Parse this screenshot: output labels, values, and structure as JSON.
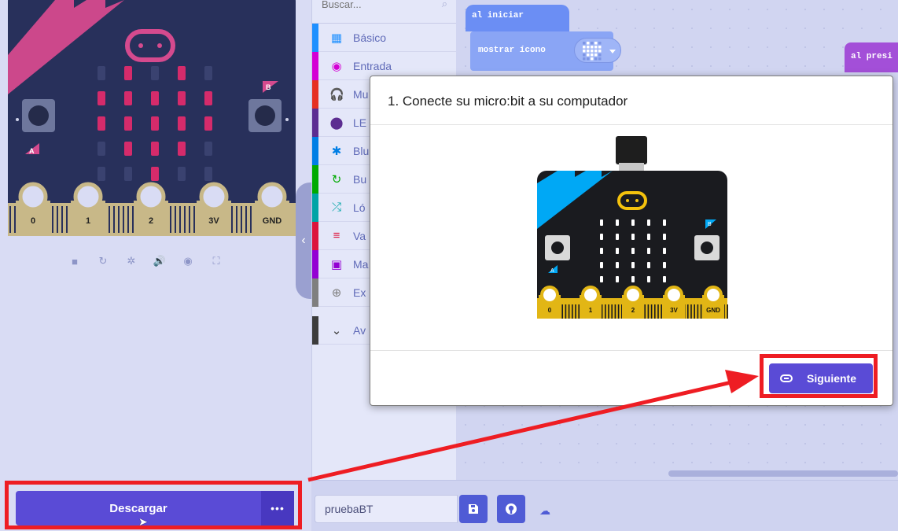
{
  "colors": {
    "accent": "#5a4bd6",
    "highlight": "#ee1d23",
    "sim_board": "#28305b",
    "sim_led": "#d52b6b",
    "sim_logo": "#d54a8e",
    "sim_corner": "#d54a8e",
    "modal_board": "#1a1b1f",
    "modal_corner": "#00a8f5",
    "gold": "#e2b615"
  },
  "simulator": {
    "pin_labels": [
      "0",
      "1",
      "2",
      "3V",
      "GND"
    ],
    "button_a": "A",
    "button_b": "B",
    "toolbar": [
      {
        "name": "stop-icon",
        "glyph": "■"
      },
      {
        "name": "restart-icon",
        "glyph": "↻"
      },
      {
        "name": "debug-icon",
        "glyph": "✲"
      },
      {
        "name": "mute-icon",
        "glyph": "🔊"
      },
      {
        "name": "screenshot-icon",
        "glyph": "◉"
      },
      {
        "name": "fullscreen-icon",
        "glyph": "⛶"
      }
    ],
    "collapse_icon": "‹"
  },
  "toolbox": {
    "search": {
      "placeholder": "Buscar...",
      "icon": "search-icon",
      "icon_glyph": "⌕"
    },
    "categories": [
      {
        "label": "Básico",
        "color": "#1e90ff",
        "icon": "grid-icon",
        "glyph": "▦"
      },
      {
        "label": "Entrada",
        "color": "#d400d4",
        "icon": "target-icon",
        "glyph": "◉"
      },
      {
        "label": "Mu",
        "color": "#e63022",
        "icon": "headphones-icon",
        "glyph": "🎧"
      },
      {
        "label": "LE",
        "color": "#5c2d91",
        "icon": "toggle-icon",
        "glyph": "⬤"
      },
      {
        "label": "Blu",
        "color": "#007ee5",
        "icon": "bluetooth-icon",
        "glyph": "✱"
      },
      {
        "label": "Bu",
        "color": "#00aa00",
        "icon": "loop-icon",
        "glyph": "↻"
      },
      {
        "label": "Ló",
        "color": "#00a4a6",
        "icon": "shuffle-icon",
        "glyph": "⤮"
      },
      {
        "label": "Va",
        "color": "#dc143c",
        "icon": "list-icon",
        "glyph": "≡"
      },
      {
        "label": "Ma",
        "color": "#9400d3",
        "icon": "calculator-icon",
        "glyph": "▣"
      },
      {
        "label": "Ex",
        "color": "#7f7f7f",
        "icon": "plus-icon",
        "glyph": "⊕"
      },
      {
        "label": "Av",
        "color": "#3c3c3c",
        "icon": "chevron-down-icon",
        "glyph": "⌄"
      }
    ]
  },
  "workspace": {
    "on_start_label": "al iniciar",
    "show_icon_label": "mostrar ícono",
    "on_button_label": "al presi"
  },
  "bottom_bar": {
    "download_label": "Descargar",
    "more_label": "•••",
    "project_name": "pruebaBT",
    "save_icon": "save-icon",
    "github_icon": "github-icon",
    "cloud_icon": "cloud-icon"
  },
  "modal": {
    "title": "1. Conecte su micro:bit a su computador",
    "board_pins": [
      "0",
      "1",
      "2",
      "3V",
      "GND"
    ],
    "button_a": "A",
    "button_b": "B",
    "next_label": "Siguiente",
    "next_icon": "link-icon"
  }
}
